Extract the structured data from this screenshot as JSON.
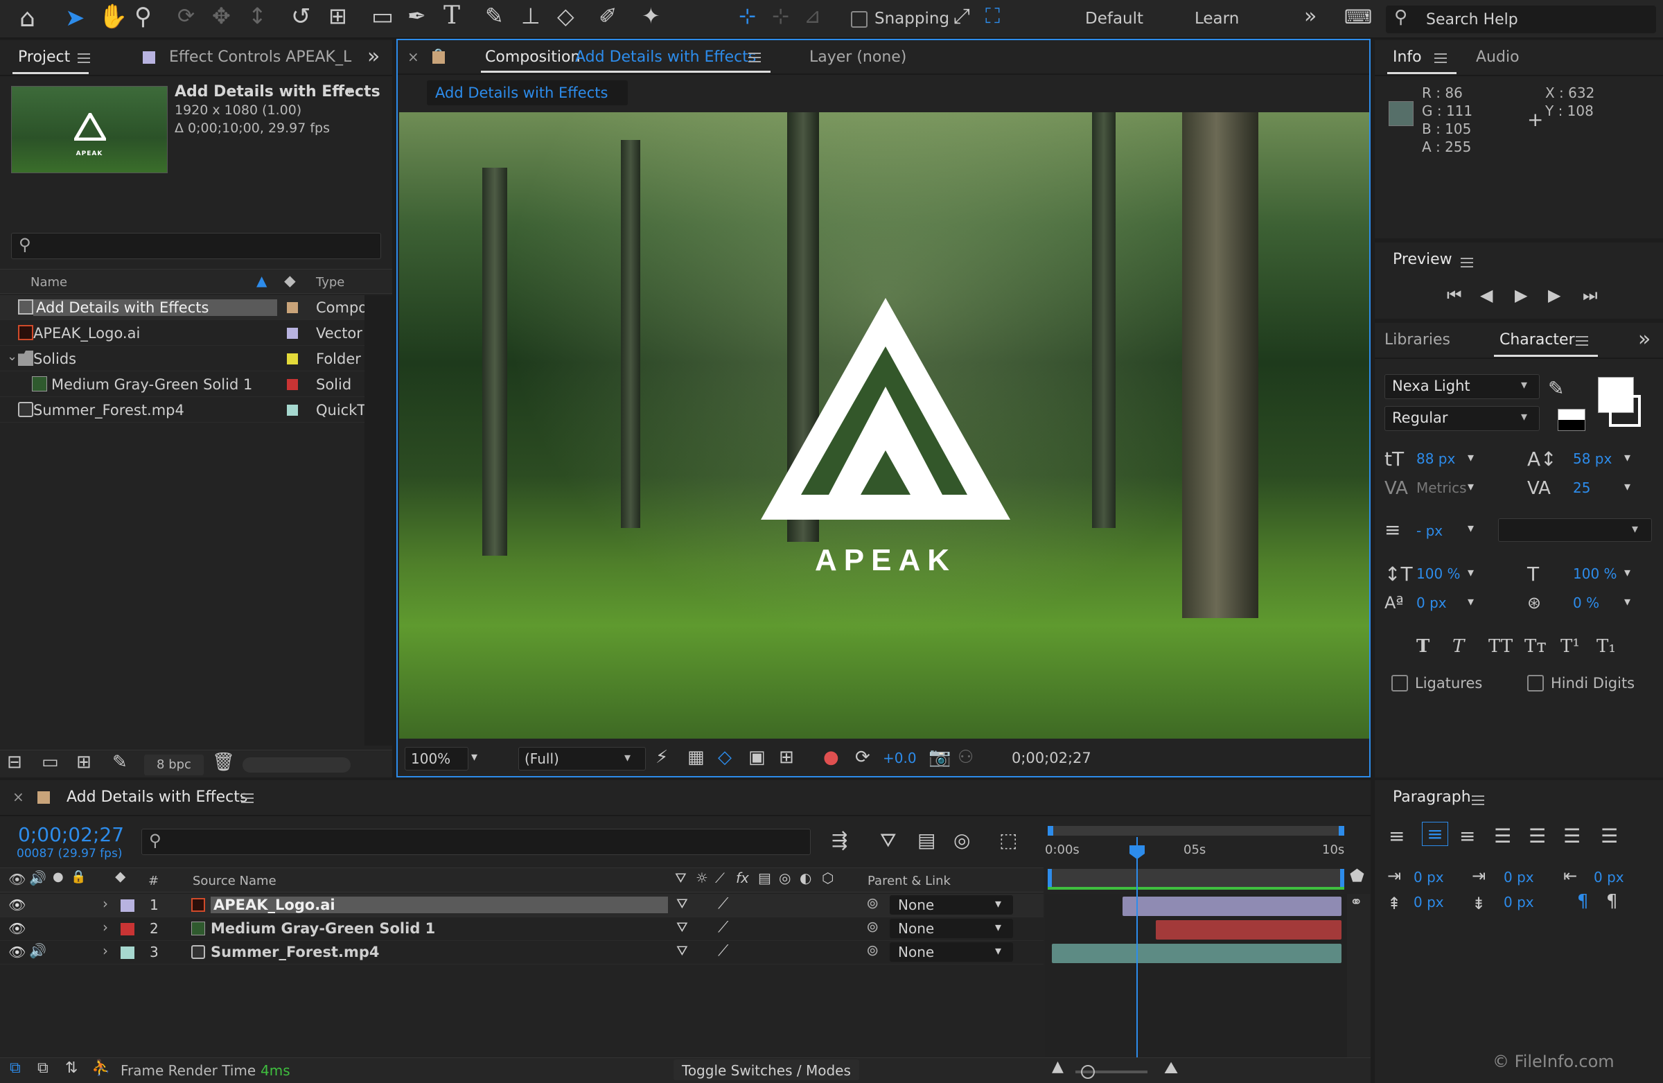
{
  "toolbar": {
    "snapping": "Snapping",
    "workspace_default": "Default",
    "workspace_learn": "Learn",
    "search_placeholder": "Search Help"
  },
  "project": {
    "tab_project": "Project",
    "tab_effect_controls": "Effect Controls APEAK_L",
    "comp_name": "Add Details with Effects",
    "comp_res": "1920 x 1080 (1.00)",
    "comp_dur": "Δ 0;00;10;00, 29.97 fps",
    "thumb_text": "APEAK",
    "col_name": "Name",
    "col_type": "Type",
    "bpc": "8 bpc",
    "items": [
      {
        "name": "Add Details with Effects",
        "type": "Compo",
        "color": "#c9a47a",
        "icon": "composition-icon"
      },
      {
        "name": "APEAK_Logo.ai",
        "type": "Vector",
        "color": "#b8b3e0",
        "icon": "illustrator-file-icon"
      },
      {
        "name": "Solids",
        "type": "Folder",
        "color": "#e3da3a",
        "icon": "folder-icon"
      },
      {
        "name": "Medium Gray-Green Solid 1",
        "type": "Solid",
        "color": "#c93434",
        "icon": "solid-icon"
      },
      {
        "name": "Summer_Forest.mp4",
        "type": "QuickTi",
        "color": "#a6d8cf",
        "icon": "video-file-icon"
      }
    ]
  },
  "comp": {
    "label": "Composition",
    "name": "Add Details with Effects",
    "layer_tab": "Layer (none)",
    "breadcrumb": "Add Details with Effects",
    "logo_text": "APEAK",
    "zoom": "100%",
    "resolution": "(Full)",
    "exposure": "+0.0",
    "timecode": "0;00;02;27"
  },
  "info": {
    "tab_info": "Info",
    "tab_audio": "Audio",
    "r": "R :  86",
    "g": "G :  111",
    "b": "B :  105",
    "a": "A :  255",
    "x": "X :  632",
    "y": "Y :  108",
    "swatch": "#566f69"
  },
  "preview": {
    "title": "Preview"
  },
  "character": {
    "tab_libraries": "Libraries",
    "tab_character": "Character",
    "font": "Nexa Light",
    "style": "Regular",
    "size": "88 px",
    "leading": "58 px",
    "kerning": "Metrics",
    "tracking": "25",
    "stroke": "- px",
    "vscale": "100 %",
    "hscale": "100 %",
    "baseline": "0 px",
    "tsume": "0 %",
    "ligatures": "Ligatures",
    "hindi": "Hindi Digits"
  },
  "timeline": {
    "title": "Add Details with Effects",
    "timecode": "0;00;02;27",
    "frames": "00087 (29.97 fps)",
    "col_num": "#",
    "col_source": "Source Name",
    "col_parent": "Parent & Link",
    "ruler_0": "0:00s",
    "ruler_5": "05s",
    "ruler_10": "10s",
    "render_label": "Frame Render Time",
    "render_value": "4ms",
    "toggle": "Toggle Switches / Modes",
    "layers": [
      {
        "num": "1",
        "name": "APEAK_Logo.ai",
        "parent": "None",
        "color": "#b8b3e0",
        "bar": "#8f8bb3"
      },
      {
        "num": "2",
        "name": "Medium Gray-Green Solid 1",
        "parent": "None",
        "color": "#c93434",
        "bar": "#a33a3a"
      },
      {
        "num": "3",
        "name": "Summer_Forest.mp4",
        "parent": "None",
        "color": "#a6d8cf",
        "bar": "#5d8b84"
      }
    ]
  },
  "paragraph": {
    "title": "Paragraph",
    "indent_left": "0 px",
    "indent_first": "0 px",
    "indent_right": "0 px",
    "space_before": "0 px",
    "space_after": "0 px"
  },
  "watermark": "© FileInfo.com"
}
